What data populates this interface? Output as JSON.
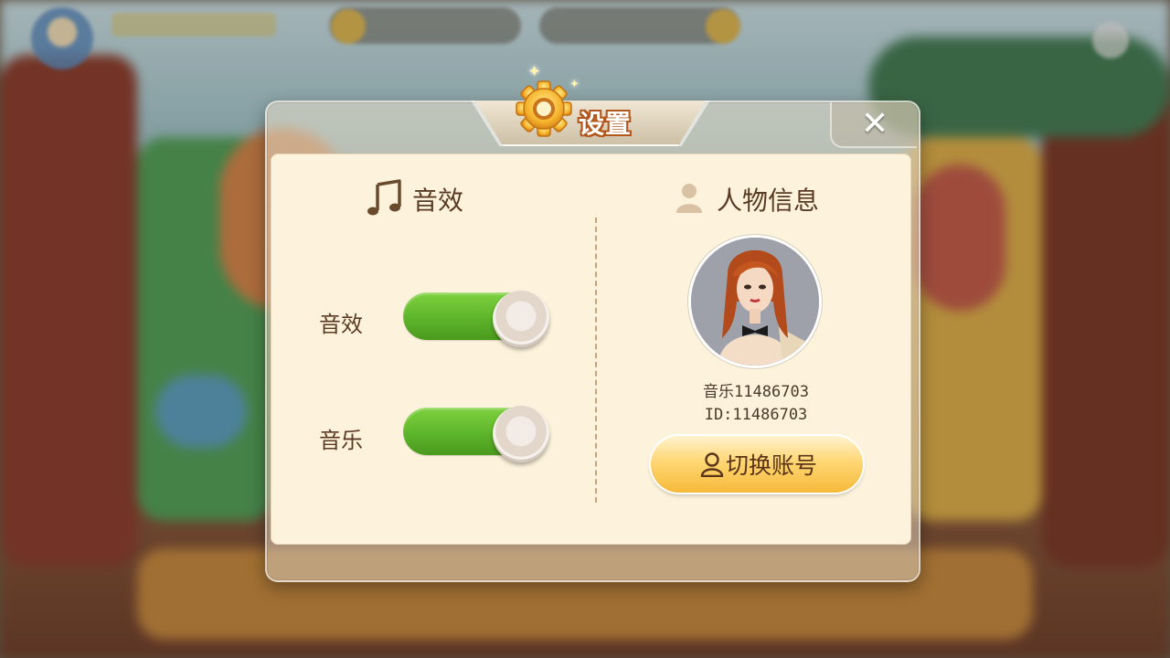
{
  "dialog": {
    "title": "设置",
    "close_icon": "close-icon"
  },
  "sound": {
    "section_title": "音效",
    "section_icon": "music-note-icon",
    "rows": [
      {
        "label": "音效",
        "enabled": true
      },
      {
        "label": "音乐",
        "enabled": true
      }
    ]
  },
  "profile": {
    "section_title": "人物信息",
    "section_icon": "person-icon",
    "nickname": "音乐11486703",
    "id_text": "ID:11486703",
    "switch_account_label": "切换账号",
    "switch_account_icon": "user-outline-icon"
  },
  "colors": {
    "panel": "#fdf3dc",
    "toggle_on": "#5db52a",
    "title_outline": "#b2561c",
    "button": "#ffd774"
  }
}
